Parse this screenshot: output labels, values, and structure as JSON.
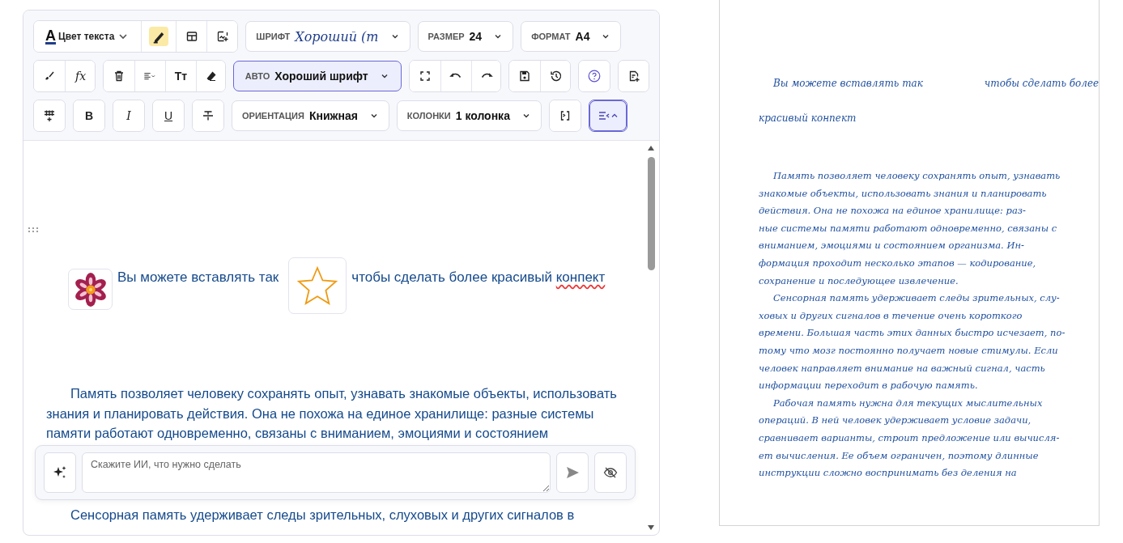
{
  "toolbar": {
    "rows": [
      {
        "controls": [
          {
            "kind": "group",
            "items": [
              {
                "kind": "text-color",
                "glyph": "A",
                "label": "Цвет текста"
              },
              {
                "kind": "highlighter",
                "active": true
              },
              {
                "kind": "table"
              },
              {
                "kind": "image-add"
              }
            ]
          },
          {
            "kind": "select",
            "label": "ШРИФТ",
            "value": "Хороший (т",
            "script": true,
            "highlighted": false
          },
          {
            "kind": "select",
            "label": "РАЗМЕР",
            "value": "24",
            "script": false,
            "highlighted": false
          },
          {
            "kind": "select",
            "label": "ФОРМАТ",
            "value": "A4",
            "script": false,
            "highlighted": false
          }
        ]
      },
      {
        "controls": [
          {
            "kind": "group",
            "items": [
              {
                "kind": "brush"
              },
              {
                "kind": "glyph",
                "glyph": "fx",
                "italic": true
              }
            ]
          },
          {
            "kind": "group",
            "items": [
              {
                "kind": "trash"
              },
              {
                "kind": "align"
              },
              {
                "kind": "glyph",
                "glyph": "Tт",
                "italic": false
              },
              {
                "kind": "eraser"
              }
            ]
          },
          {
            "kind": "select",
            "label": "АВТО",
            "value": "Хороший шрифт",
            "script": false,
            "highlighted": true
          },
          {
            "kind": "group",
            "items": [
              {
                "kind": "fullscreen"
              },
              {
                "kind": "undo"
              },
              {
                "kind": "redo"
              }
            ]
          },
          {
            "kind": "group",
            "items": [
              {
                "kind": "save"
              },
              {
                "kind": "history"
              }
            ]
          },
          {
            "kind": "group",
            "items": [
              {
                "kind": "help"
              }
            ]
          },
          {
            "kind": "group",
            "items": [
              {
                "kind": "add-doc"
              }
            ]
          }
        ]
      },
      {
        "controls": [
          {
            "kind": "group",
            "items": [
              {
                "kind": "table-insert"
              }
            ]
          },
          {
            "kind": "group",
            "items": [
              {
                "kind": "glyph",
                "glyph": "B",
                "italic": false
              }
            ]
          },
          {
            "kind": "group",
            "items": [
              {
                "kind": "glyph",
                "glyph": "I",
                "italic": true
              }
            ]
          },
          {
            "kind": "group",
            "items": [
              {
                "kind": "glyph",
                "glyph": "U",
                "italic": false,
                "underline": true
              }
            ]
          },
          {
            "kind": "group",
            "items": [
              {
                "kind": "strike"
              }
            ]
          },
          {
            "kind": "select",
            "label": "ОРИЕНТАЦИЯ",
            "value": "Книжная",
            "script": false,
            "highlighted": false
          },
          {
            "kind": "select",
            "label": "КОЛОНКИ",
            "value": "1 колонка",
            "script": false,
            "highlighted": false
          },
          {
            "kind": "group",
            "items": [
              {
                "kind": "code"
              }
            ]
          },
          {
            "kind": "group",
            "items": [
              {
                "kind": "outline",
                "active": true
              }
            ]
          }
        ]
      }
    ]
  },
  "editor": {
    "inline_row": [
      {
        "kind": "flower"
      },
      {
        "kind": "text",
        "text": "Вы можете вставлять так"
      },
      {
        "kind": "star"
      },
      {
        "kind": "text",
        "segments": [
          {
            "text": "чтобы сделать более красивый ",
            "misspelled": false
          },
          {
            "text": "конпект",
            "misspelled": true
          }
        ]
      }
    ],
    "paragraph_before": "Память позволяет человеку сохранять опыт, узнавать знакомые объекты, использовать знания и планировать действия. Она не похожа на единое хранилище: разные системы памяти работают одновременно, связаны с вниманием, эмоциями и состоянием",
    "ai_prompt": {
      "placeholder": "Скажите ИИ, что нужно сделать"
    },
    "paragraph_after": "Сенсорная память удерживает следы зрительных, слуховых и других сигналов в"
  },
  "preview": {
    "inline_lines": [
      [
        "Вы можете вставлять так",
        "чтобы сделать более"
      ],
      [
        "красивый конпект"
      ]
    ],
    "paragraphs": [
      [
        "Память позволяет человеку сохранять опыт, узнавать",
        "знакомые объекты, использовать знания и планировать",
        "действия. Она не похожа на единое хранилище: раз-",
        "ные системы памяти работают одновременно, связаны с",
        "вниманием, эмоциями и состоянием организма. Ин-",
        "формация проходит несколько этапов — кодирование,",
        "сохранение и последующее извлечение."
      ],
      [
        "Сенсорная память удерживает следы зрительных, слу-",
        "ховых и других сигналов в течение очень короткого",
        "времени. Большая часть этих данных быстро исчезает, по-",
        "тому что мозг постоянно получает новые стимулы. Если",
        "человек направляет внимание на важный сигнал, часть",
        "информации переходит в рабочую память."
      ],
      [
        "Рабочая память нужна для текущих мыслительных",
        "операций. В ней человек удерживает условие задачи,",
        "сравнивает варианты, строит предложение или вычисля-",
        "ет вычисления. Ее объем ограничен, поэтому длинные",
        "инструкции сложно воспринимать без деления на"
      ]
    ]
  }
}
